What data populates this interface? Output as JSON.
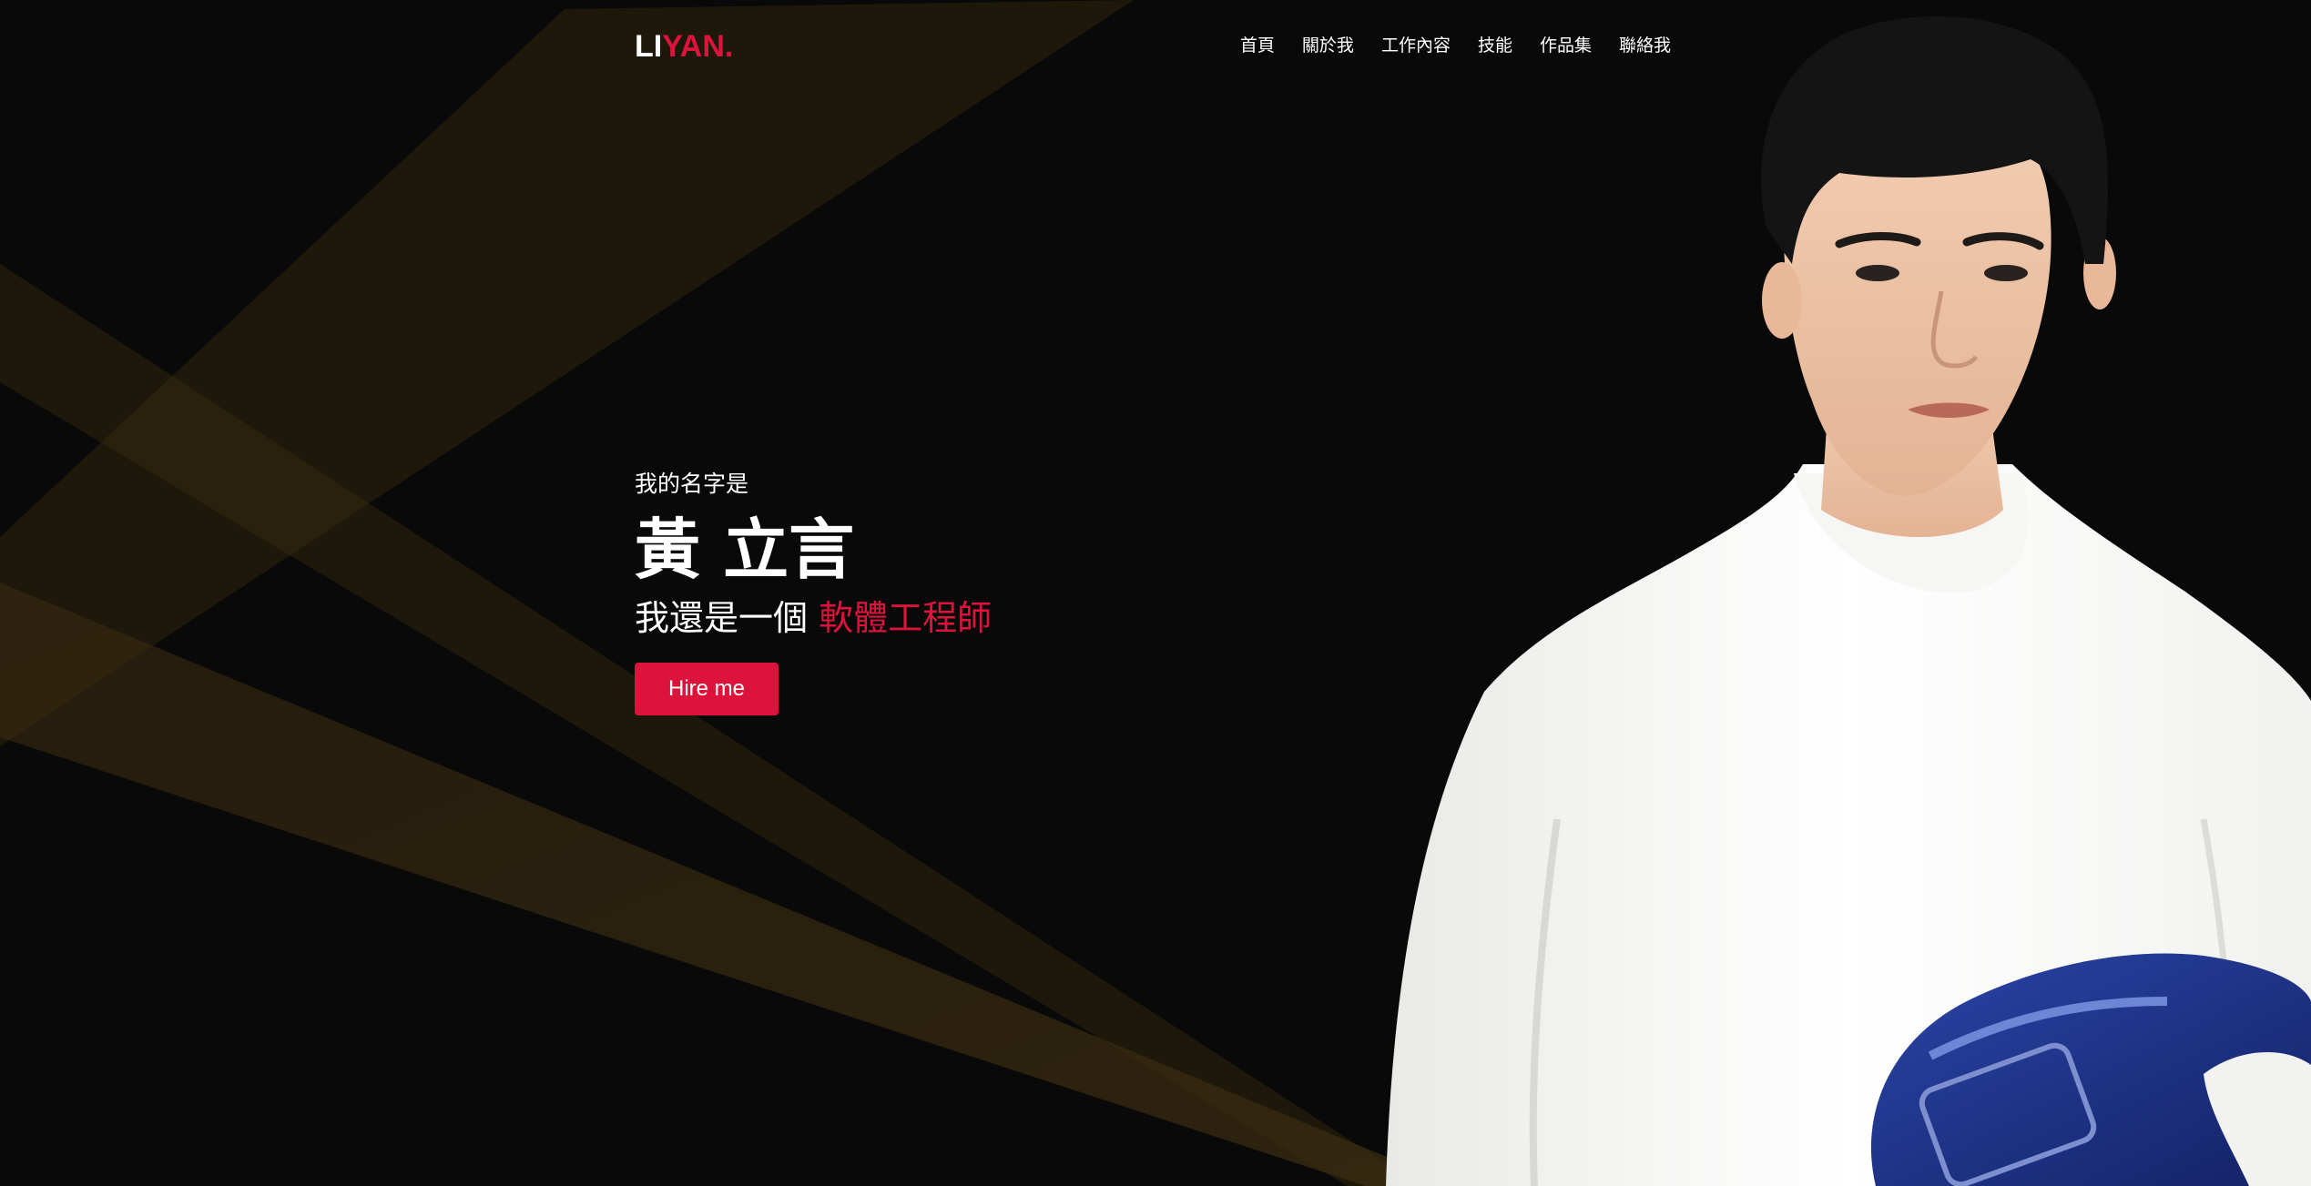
{
  "brand": {
    "logo_prefix": "LI",
    "logo_suffix": "YAN.",
    "accent_color": "#dc143c"
  },
  "nav": {
    "items": [
      "首頁",
      "關於我",
      "工作內容",
      "技能",
      "作品集",
      "聯絡我"
    ]
  },
  "hero": {
    "intro": "我的名字是",
    "name": "黃 立言",
    "role_prefix": "我還是一個",
    "role_highlight": "軟體工程師",
    "cta_label": "Hire me"
  },
  "colors": {
    "background": "#090909",
    "ray": "#3a2c10",
    "text": "#ffffff"
  }
}
